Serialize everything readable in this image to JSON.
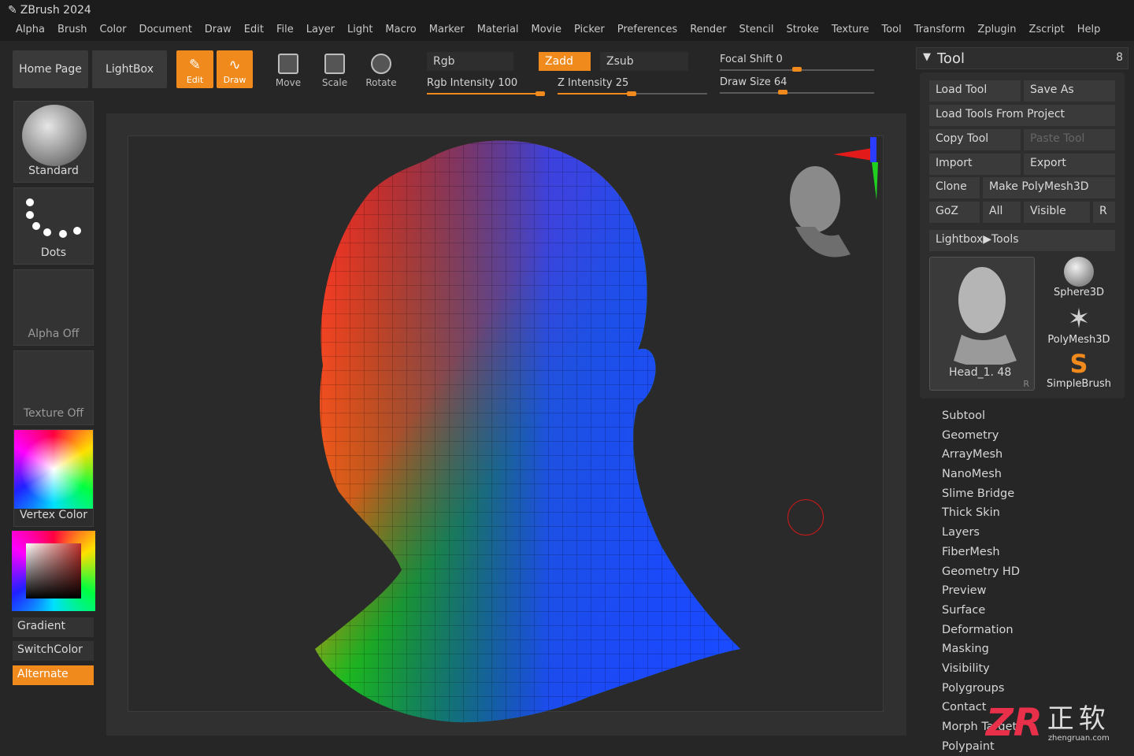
{
  "app": {
    "title": "ZBrush 2024"
  },
  "menu": [
    "Alpha",
    "Brush",
    "Color",
    "Document",
    "Draw",
    "Edit",
    "File",
    "Layer",
    "Light",
    "Macro",
    "Marker",
    "Material",
    "Movie",
    "Picker",
    "Preferences",
    "Render",
    "Stencil",
    "Stroke",
    "Texture",
    "Tool",
    "Transform",
    "Zplugin",
    "Zscript",
    "Help"
  ],
  "toolbar": {
    "home": "Home Page",
    "lightbox": "LightBox",
    "edit": "Edit",
    "draw": "Draw",
    "move": "Move",
    "scale": "Scale",
    "rotate": "Rotate",
    "rgb": "Rgb",
    "rgb_intensity": "Rgb Intensity 100",
    "rgb_intensity_value": 100,
    "zadd": "Zadd",
    "zsub": "Zsub",
    "z_intensity": "Z Intensity 25",
    "z_intensity_value": 25,
    "focal_shift": "Focal Shift 0",
    "draw_size": "Draw Size 64",
    "accent": "#f08a1c"
  },
  "left": {
    "brush": "Standard",
    "stroke": "Dots",
    "alpha": "Alpha Off",
    "texture": "Texture Off",
    "material": "Vertex Color",
    "gradient": "Gradient",
    "switch": "SwitchColor",
    "alternate": "Alternate"
  },
  "tool": {
    "header": "Tool",
    "header_icon": "8",
    "load": "Load Tool",
    "save": "Save As",
    "load_project": "Load Tools From Project",
    "copy": "Copy Tool",
    "paste": "Paste Tool",
    "import": "Import",
    "export": "Export",
    "clone": "Clone",
    "make_poly": "Make PolyMesh3D",
    "goz": "GoZ",
    "all": "All",
    "visible": "Visible",
    "r": "R",
    "lightbox_tools": "Lightbox▶Tools",
    "current": "Head_1. 48",
    "current_r": "R",
    "thumbs": [
      "Sphere3D",
      "PolyMesh3D",
      "SimpleBrush"
    ],
    "subpalettes": [
      "Subtool",
      "Geometry",
      "ArrayMesh",
      "NanoMesh",
      "Slime Bridge",
      "Thick Skin",
      "Layers",
      "FiberMesh",
      "Geometry HD",
      "Preview",
      "Surface",
      "Deformation",
      "Masking",
      "Visibility",
      "Polygroups",
      "Contact",
      "Morph Target",
      "Polypaint"
    ]
  },
  "watermark": {
    "logo": "ZR",
    "cn": "正软",
    "url": "zhengruan.com"
  }
}
